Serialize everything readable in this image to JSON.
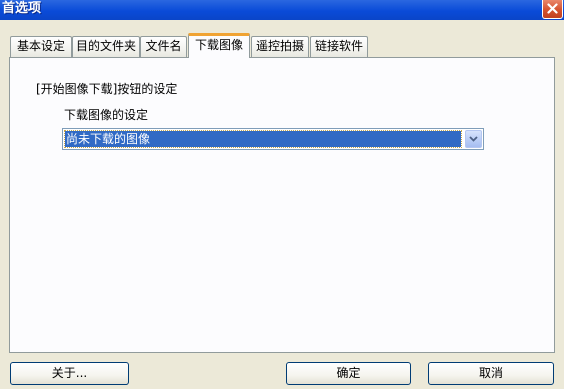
{
  "window": {
    "title": "首选项"
  },
  "tabs": [
    {
      "label": "基本设定"
    },
    {
      "label": "目的文件夹"
    },
    {
      "label": "文件名"
    },
    {
      "label": "下载图像",
      "active": true
    },
    {
      "label": "遥控拍摄"
    },
    {
      "label": "链接软件"
    }
  ],
  "panel": {
    "section_label": "[开始图像下载]按钮的设定",
    "sub_label": "下载图像的设定",
    "select": {
      "value": "尚未下载的图像"
    }
  },
  "buttons": {
    "about": "关于...",
    "ok": "确定",
    "cancel": "取消"
  },
  "colors": {
    "titlebar": "#0a4bd8",
    "active_tab_accent": "#f0a333",
    "selection": "#316ac5",
    "window_bg": "#ece9d8"
  },
  "icons": {
    "close": "close-icon",
    "dropdown": "chevron-down-icon"
  }
}
